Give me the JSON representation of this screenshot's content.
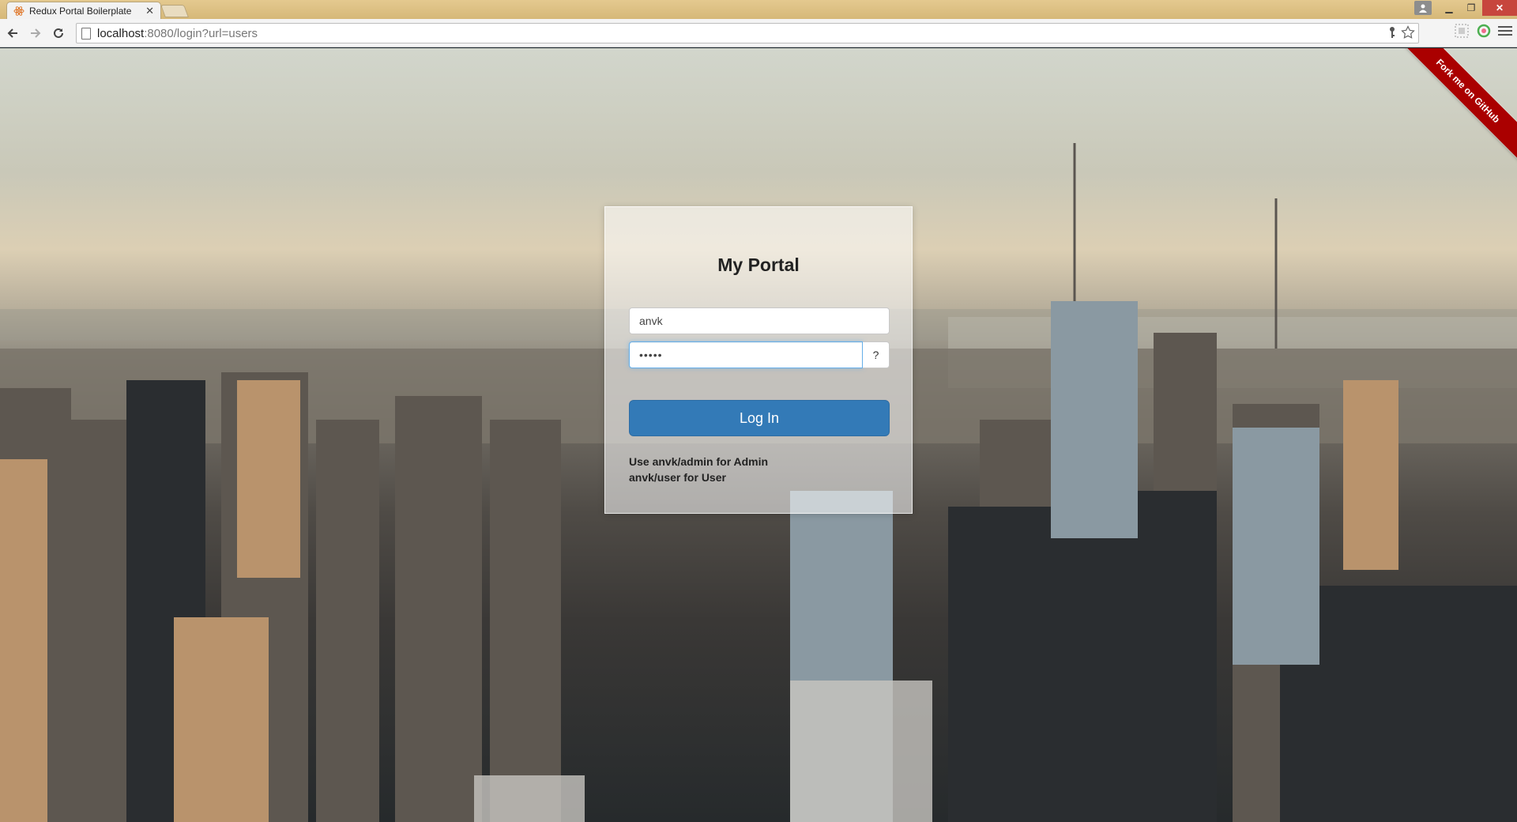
{
  "browser": {
    "tab_title": "Redux Portal Boilerplate",
    "url_host": "localhost",
    "url_rest": ":8080/login?url=users"
  },
  "ribbon": {
    "label": "Fork me on GitHub",
    "color": "#aa0000"
  },
  "login": {
    "title": "My Portal",
    "username_value": "anvk",
    "password_value": "anvk/",
    "help_label": "?",
    "submit_label": "Log In",
    "hint_line1": "Use anvk/admin for Admin",
    "hint_line2": "anvk/user for User",
    "button_color": "#337ab7"
  },
  "icons": {
    "back": "back-arrow-icon",
    "forward": "forward-arrow-icon",
    "reload": "reload-icon",
    "key": "key-icon",
    "star": "star-icon",
    "menu": "hamburger-menu-icon"
  }
}
